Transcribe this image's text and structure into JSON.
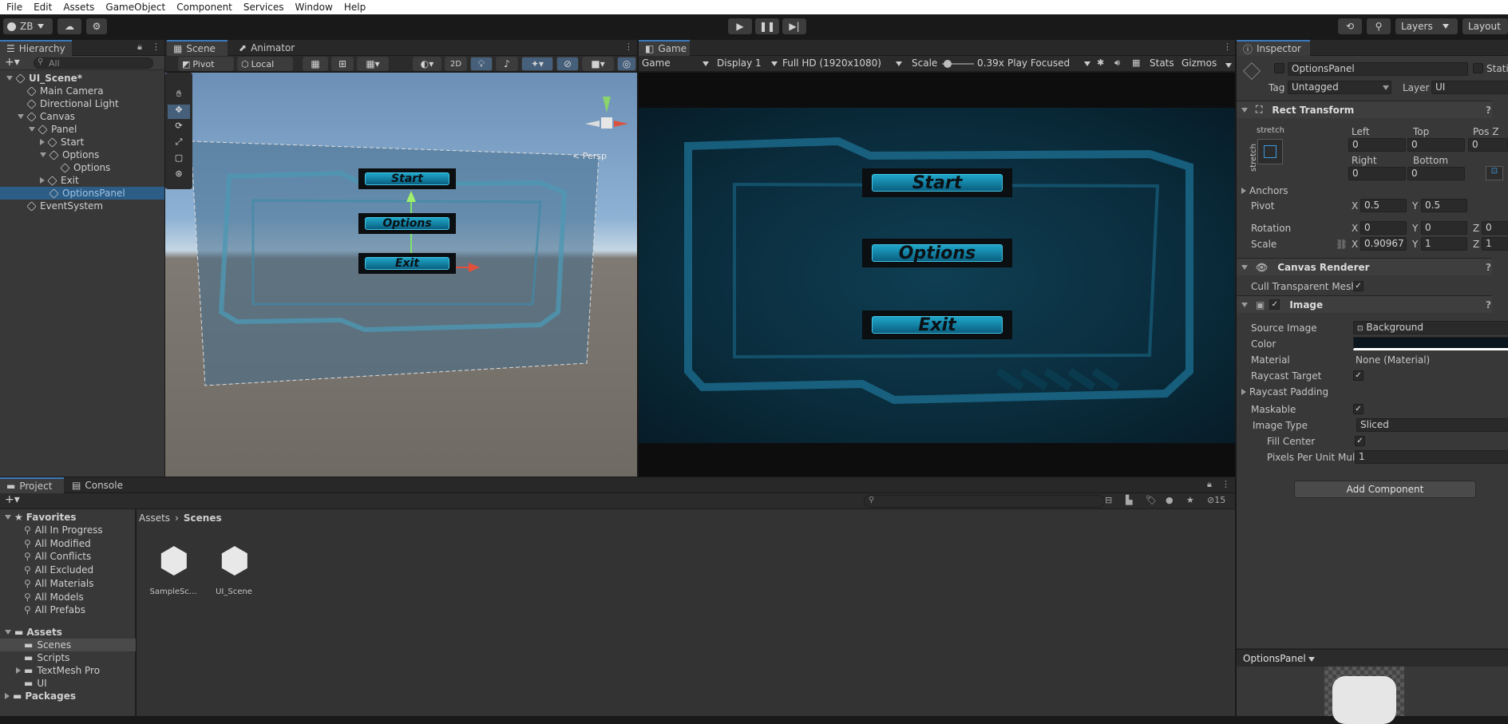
{
  "menu": [
    "File",
    "Edit",
    "Assets",
    "GameObject",
    "Component",
    "Services",
    "Window",
    "Help"
  ],
  "toolbar": {
    "account": "ZB",
    "layers": "Layers",
    "layout": "Layout"
  },
  "hierarchy": {
    "tab": "Hierarchy",
    "search_placeholder": "All",
    "items": [
      {
        "label": "UI_Scene*",
        "indent": 0,
        "arrow": "down",
        "bold": true,
        "scene": true
      },
      {
        "label": "Main Camera",
        "indent": 1,
        "arrow": "none"
      },
      {
        "label": "Directional Light",
        "indent": 1,
        "arrow": "none"
      },
      {
        "label": "Canvas",
        "indent": 1,
        "arrow": "down"
      },
      {
        "label": "Panel",
        "indent": 2,
        "arrow": "down"
      },
      {
        "label": "Start",
        "indent": 3,
        "arrow": "right"
      },
      {
        "label": "Options",
        "indent": 3,
        "arrow": "down"
      },
      {
        "label": "Options",
        "indent": 4,
        "arrow": "none"
      },
      {
        "label": "Exit",
        "indent": 3,
        "arrow": "right"
      },
      {
        "label": "OptionsPanel",
        "indent": 3,
        "arrow": "none",
        "selected": true
      },
      {
        "label": "EventSystem",
        "indent": 1,
        "arrow": "none"
      }
    ]
  },
  "scene": {
    "tabs": [
      "Scene",
      "Animator"
    ],
    "pivot": "Pivot",
    "local": "Local",
    "mode2d": "2D",
    "persp": "< Persp",
    "buttons": [
      "Start",
      "Options",
      "Exit"
    ]
  },
  "game": {
    "tab": "Game",
    "display_mode": "Game",
    "display": "Display 1",
    "resolution": "Full HD (1920x1080)",
    "scale_label": "Scale",
    "scale_value": "0.39x",
    "play_mode": "Play Focused",
    "stats": "Stats",
    "gizmos": "Gizmos",
    "buttons": [
      "Start",
      "Options",
      "Exit"
    ]
  },
  "inspector": {
    "tab": "Inspector",
    "name": "OptionsPanel",
    "static": "Static",
    "tag_label": "Tag",
    "tag": "Untagged",
    "layer_label": "Layer",
    "layer": "UI",
    "rect_transform": "Rect Transform",
    "stretch": "stretch",
    "left_label": "Left",
    "top_label": "Top",
    "posz_label": "Pos Z",
    "left": "0",
    "top": "0",
    "posz": "0",
    "right_label": "Right",
    "bottom_label": "Bottom",
    "right": "0",
    "bottom": "0",
    "anchors": "Anchors",
    "pivot_label": "Pivot",
    "pivot_x": "0.5",
    "pivot_y": "0.5",
    "rotation_label": "Rotation",
    "rot_x": "0",
    "rot_y": "0",
    "rot_z": "0",
    "scale_label": "Scale",
    "scale_x": "0.90967",
    "scale_y": "1",
    "scale_z": "1",
    "canvas_renderer": "Canvas Renderer",
    "cull_label": "Cull Transparent Mesh",
    "image": "Image",
    "source_image_label": "Source Image",
    "source_image": "Background",
    "color_label": "Color",
    "material_label": "Material",
    "material": "None (Material)",
    "raycast_target": "Raycast Target",
    "raycast_padding": "Raycast Padding",
    "maskable": "Maskable",
    "image_type_label": "Image Type",
    "image_type": "Sliced",
    "fill_center": "Fill Center",
    "ppu_label": "Pixels Per Unit Multi",
    "ppu": "1",
    "add_component": "Add Component",
    "preview_label": "OptionsPanel"
  },
  "project": {
    "tabs": [
      "Project",
      "Console"
    ],
    "hidden_count": "15",
    "breadcrumb": [
      "Assets",
      "Scenes"
    ],
    "favorites_label": "Favorites",
    "favorites": [
      "All In Progress",
      "All Modified",
      "All Conflicts",
      "All Excluded",
      "All Materials",
      "All Models",
      "All Prefabs"
    ],
    "assets_label": "Assets",
    "folders": [
      "Scenes",
      "Scripts",
      "TextMesh Pro",
      "UI"
    ],
    "packages_label": "Packages",
    "files": [
      "SampleSc...",
      "UI_Scene"
    ]
  }
}
